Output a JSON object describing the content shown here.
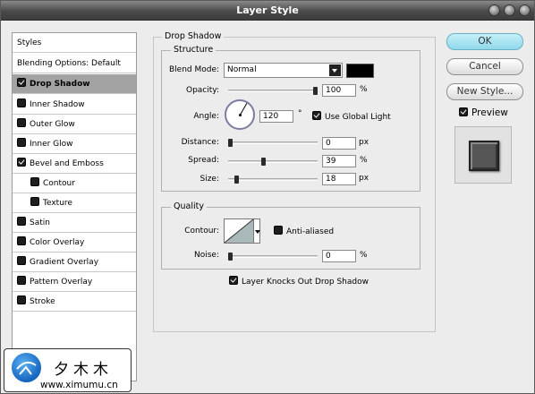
{
  "window": {
    "title": "Layer Style"
  },
  "styles_list": {
    "items": [
      {
        "label": "Styles"
      },
      {
        "label": "Blending Options: Default"
      },
      {
        "label": "Drop Shadow",
        "checked": true,
        "selected": true
      },
      {
        "label": "Inner Shadow",
        "checked": false
      },
      {
        "label": "Outer Glow",
        "checked": false
      },
      {
        "label": "Inner Glow",
        "checked": false
      },
      {
        "label": "Bevel and Emboss",
        "checked": true
      },
      {
        "label": "Contour",
        "checked": false
      },
      {
        "label": "Texture",
        "checked": false
      },
      {
        "label": "Satin",
        "checked": false
      },
      {
        "label": "Color Overlay",
        "checked": false
      },
      {
        "label": "Gradient Overlay",
        "checked": false
      },
      {
        "label": "Pattern Overlay",
        "checked": false
      },
      {
        "label": "Stroke",
        "checked": false
      }
    ]
  },
  "drop_shadow": {
    "title": "Drop Shadow",
    "structure": {
      "title": "Structure",
      "blend_mode_label": "Blend Mode:",
      "blend_mode_value": "Normal",
      "shadow_color": "#000000",
      "opacity_label": "Opacity:",
      "opacity_value": "100",
      "opacity_unit": "%",
      "opacity_fraction": 1.0,
      "angle_label": "Angle:",
      "angle_value": "120",
      "angle_unit": "°",
      "use_global_light_label": "Use Global Light",
      "use_global_light_checked": true,
      "distance_label": "Distance:",
      "distance_value": "0",
      "distance_unit": "px",
      "distance_fraction": 0.0,
      "spread_label": "Spread:",
      "spread_value": "39",
      "spread_unit": "%",
      "spread_fraction": 0.39,
      "size_label": "Size:",
      "size_value": "18",
      "size_unit": "px",
      "size_fraction": 0.07
    },
    "quality": {
      "title": "Quality",
      "contour_label": "Contour:",
      "anti_aliased_label": "Anti-aliased",
      "anti_aliased_checked": false,
      "noise_label": "Noise:",
      "noise_value": "0",
      "noise_unit": "%",
      "noise_fraction": 0.0
    },
    "knockout_label": "Layer Knocks Out Drop Shadow",
    "knockout_checked": true
  },
  "buttons": {
    "ok": "OK",
    "cancel": "Cancel",
    "new_style": "New Style...",
    "preview_label": "Preview",
    "preview_checked": true
  },
  "watermark": {
    "chars": "夕木木",
    "url": "www.ximumu.cn"
  },
  "colors": {
    "title_bar": "#4a4a4a",
    "ok_button": "#a8e2f0",
    "selected_row": "#a3a3a3"
  }
}
